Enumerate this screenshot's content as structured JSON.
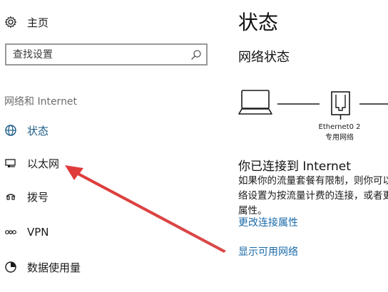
{
  "nav": {
    "home_label": "主页",
    "search_placeholder": "查找设置",
    "section_title": "网络和 Internet",
    "items": [
      {
        "label": "状态",
        "icon": "globe-icon"
      },
      {
        "label": "以太网",
        "icon": "ethernet-icon"
      },
      {
        "label": "拨号",
        "icon": "dialup-icon"
      },
      {
        "label": "VPN",
        "icon": "vpn-icon"
      },
      {
        "label": "数据使用量",
        "icon": "data-usage-icon"
      }
    ]
  },
  "content": {
    "title": "状态",
    "subtitle": "网络状态",
    "adapter_name": "Ethernet0 2",
    "adapter_type": "专用网络",
    "connected_title": "你已连接到 Internet",
    "description": "如果你的流量套餐有限制，则你可以将此网络设置为按流量计费的连接，或者更改其他属性。",
    "links": {
      "change_properties": "更改连接属性",
      "show_networks": "显示可用网络"
    }
  },
  "colors": {
    "accent_link": "#1a6aa8",
    "annotation_arrow": "#e03a3a",
    "active_icon": "#1a5a86"
  }
}
